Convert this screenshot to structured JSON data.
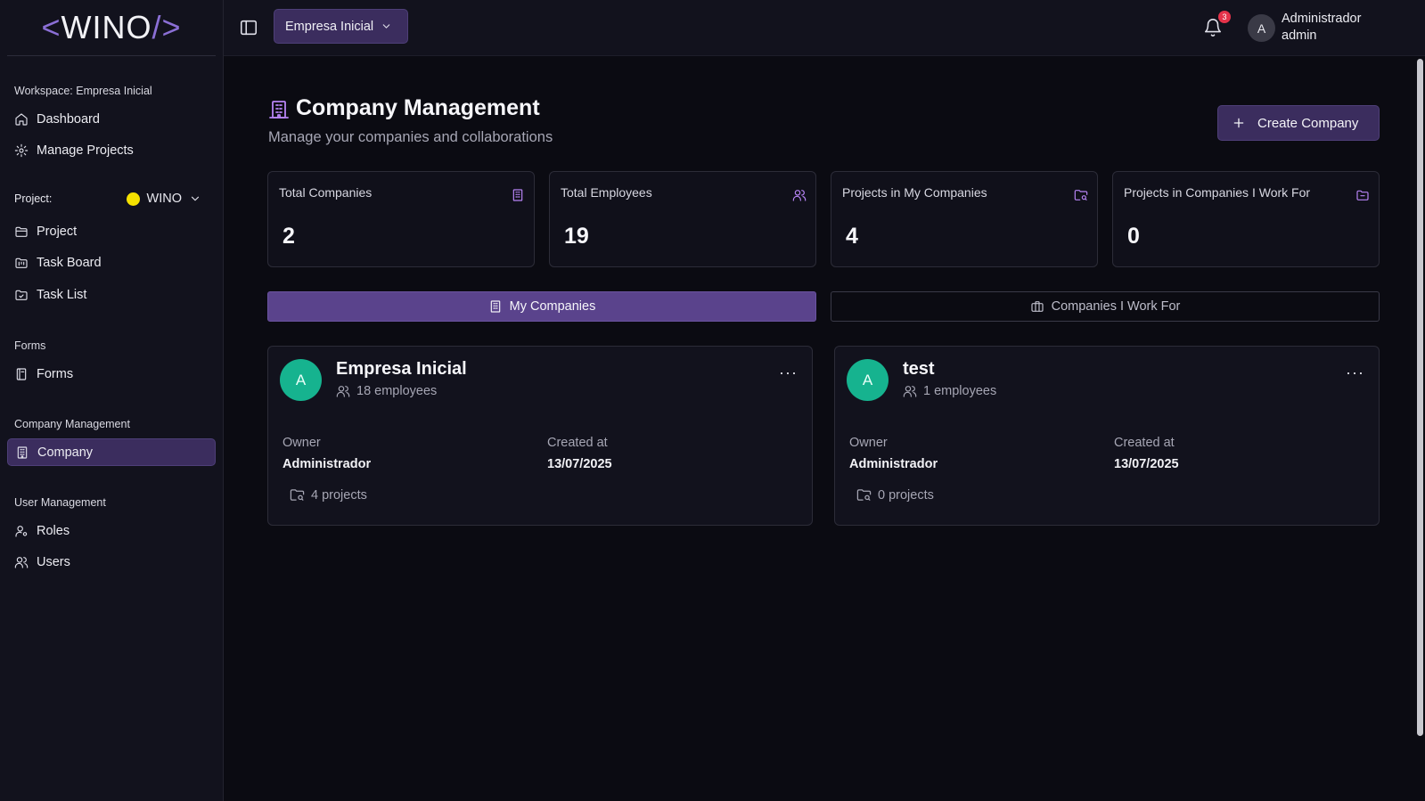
{
  "app": {
    "logo": {
      "left": "<",
      "name": "WINO",
      "right": "/>"
    }
  },
  "sidebar": {
    "workspace_label": "Workspace: Empresa Inicial",
    "workspace_items": [
      {
        "label": "Dashboard",
        "icon": "home-icon"
      },
      {
        "label": "Manage Projects",
        "icon": "gear-icon"
      }
    ],
    "project_label": "Project:",
    "project_selected": "WINO",
    "project_color": "#f5e100",
    "project_items": [
      {
        "label": "Project",
        "icon": "folder-open-icon"
      },
      {
        "label": "Task Board",
        "icon": "folder-kanban-icon"
      },
      {
        "label": "Task List",
        "icon": "folder-check-icon"
      }
    ],
    "forms_label": "Forms",
    "forms_items": [
      {
        "label": "Forms",
        "icon": "notebook-icon"
      }
    ],
    "company_label": "Company Management",
    "company_items": [
      {
        "label": "Company",
        "icon": "building-icon",
        "active": true
      }
    ],
    "users_label": "User Management",
    "users_items": [
      {
        "label": "Roles",
        "icon": "user-cog-icon"
      },
      {
        "label": "Users",
        "icon": "users-icon"
      }
    ]
  },
  "topbar": {
    "company_select": "Empresa Inicial",
    "notifications_count": "3",
    "user": {
      "avatar": "A",
      "name": "Administrador",
      "role": "admin"
    }
  },
  "page": {
    "title": "Company Management",
    "subtitle": "Manage your companies and collaborations",
    "create_button": "Create Company"
  },
  "stats": [
    {
      "label": "Total Companies",
      "value": "2",
      "icon": "building-icon"
    },
    {
      "label": "Total Employees",
      "value": "19",
      "icon": "users-icon"
    },
    {
      "label": "Projects in My Companies",
      "value": "4",
      "icon": "folder-search-icon"
    },
    {
      "label": "Projects in Companies I Work For",
      "value": "0",
      "icon": "folder-icon"
    }
  ],
  "tabs": [
    {
      "label": "My Companies",
      "active": true,
      "icon": "building-icon"
    },
    {
      "label": "Companies I Work For",
      "active": false,
      "icon": "briefcase-icon"
    }
  ],
  "companies": [
    {
      "avatar": "A",
      "name": "Empresa Inicial",
      "employees": "18 employees",
      "owner_label": "Owner",
      "owner": "Administrador",
      "created_label": "Created at",
      "created": "13/07/2025",
      "projects": "4 projects",
      "menu": "···"
    },
    {
      "avatar": "A",
      "name": "test",
      "employees": "1 employees",
      "owner_label": "Owner",
      "owner": "Administrador",
      "created_label": "Created at",
      "created": "13/07/2025",
      "projects": "0 projects",
      "menu": "···"
    }
  ],
  "colors": {
    "accent": "#3b2d5e",
    "accent_active_tab": "#5a438c",
    "avatar_green": "#16b38f",
    "badge_red": "#e5334a",
    "icon_purple": "#b784f5"
  }
}
